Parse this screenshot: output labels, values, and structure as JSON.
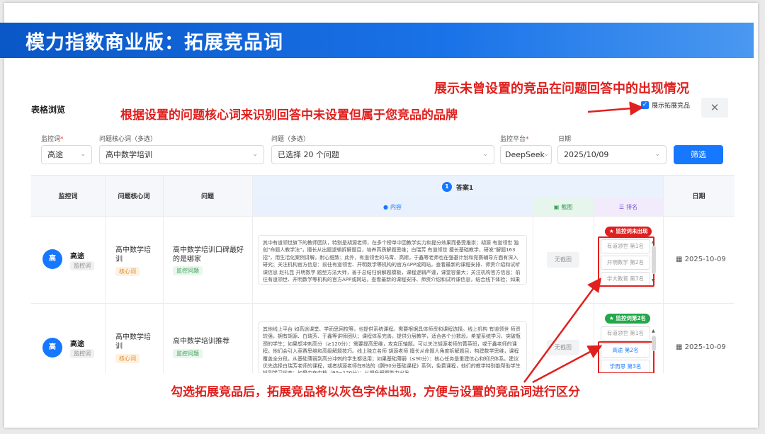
{
  "slide": {
    "title": "模力指数商业版：拓展竞品词",
    "annotation_top": "展示未曾设置的竞品在问题回答中的出现情况",
    "annotation_mid": "根据设置的问题核心词来识别回答中未设置但属于您竞品的品牌",
    "annotation_bottom": "勾选拓展竞品后，拓展竞品将以灰色字体出现，方便与设置的竞品词进行区分",
    "accent_red": "#e0201e",
    "brand_blue": "#1677ff"
  },
  "panel": {
    "section_label": "表格浏览",
    "checkbox_label": "展示拓展竞品",
    "checkbox_checked": true,
    "close_icon": "close-icon"
  },
  "filters": {
    "monitor_word": {
      "label": "监控词",
      "required": "*",
      "value": "高途"
    },
    "core_word": {
      "label": "问题核心词（多选）",
      "value": "高中数学培训"
    },
    "questions": {
      "label": "问题（多选）",
      "value": "已选择 20 个问题"
    },
    "platform": {
      "label": "监控平台",
      "required": "*",
      "value": "DeepSeek"
    },
    "date": {
      "label": "日期",
      "value": "2025/10/09"
    },
    "submit_label": "筛选"
  },
  "table": {
    "headers": {
      "monitor_word": "监控词",
      "core_word": "问题核心词",
      "question": "问题",
      "answer_num": "1",
      "answer": "答案1",
      "content": "内容",
      "screenshot": "截图",
      "rank": "排名",
      "date": "日期"
    },
    "rows": [
      {
        "avatar": "高",
        "monitor_word": "高途",
        "monitor_tag": "监控词",
        "core_word": "高中数学培训",
        "core_tag": "核心词",
        "question": "高中数学培训口碑最好的是哪家",
        "question_tag": "监控问题",
        "content": "其中有道领世旗下的教师团队，特别是胡源老师，在多个榜单中因教学实力和提分效果而备受推崇；胡源 有道领世 独创\"命题人教学法\"，擅长从出题逻辑拆解题目，培养高质解题思维；白瑞芳 有道领世 擅长基础教学，研发\"解题163招\"，用生活化案例讲解，耐心细致；此外，有道领世的马霄、高斯，于鑫等老师也在强基计划和竞赛辅导方面有深入研究；关注机构官方信息：前往有道领世、开明数学等机构的官方APP或网站，查看最新的课程安排、师资介绍和试听课信息 赵礼昆 开明数学 题型方法大师，善于总结归纳解题模板，课程逻辑严谨，课堂容量大；关注机构官方信息：前往有道领世、开明数学等机构的官方APP或网站，查看最新的课程安排、师资介绍和试听课信息，结合线下体验；如果条件允许实地参观，与您孩子来高中数学，帮助家长选择适合的学习方式。",
        "screenshot": "无截图",
        "rank_badge": "监控词未出现",
        "ranks": [
          "有道领世 第1名",
          "开明数学 第2名",
          "学大教育 第3名"
        ],
        "date": "2025-10-09"
      },
      {
        "avatar": "高",
        "monitor_word": "高途",
        "monitor_tag": "监控词",
        "core_word": "高中数学培训",
        "core_tag": "核心词",
        "question": "高中数学培训推荐",
        "question_tag": "监控问题",
        "content": "其他线上平台 如高途课堂、学而思网校等，也提供系统课程。需要根据具体师资和课程选择。线上机构 有道领世 师资较强，拥有胡源、白瑞芳、于鑫等讲师团队；课程体系完善，提供分层教学，适合各个分数段。希望系统学习、突破瓶颈的学生；如果想冲刺高分（≥120分）：需要提高思维，攻克压轴题。可以关注胡源老师的菁英班，或于鑫老师的课程。他们会引入竞赛思维和高级解题技巧。线上独立名师 胡源老师 擅长从命题人角度拆解题目，构建数学思维，课程覆盖全分段。从基础薄弱到高分冲刺的学生都适用；如果基础薄弱（≤90分）：核心任务是重建信心和知识体系。建议优先选择白瑞芳老师的课程，或者胡源老师在B站的《腾90分基础课程》系列，免费课程，他们的教学特别能帮助学生找到学习状态；如果中在中档（90~120分）：从提升解题能力出发。",
        "screenshot": "无截图",
        "rank_badge": "监控词第2名",
        "ranks": [
          "有道领世 第1名",
          "高途 第2名",
          "学而思 第3名"
        ],
        "date": "2025-10-09"
      }
    ]
  }
}
